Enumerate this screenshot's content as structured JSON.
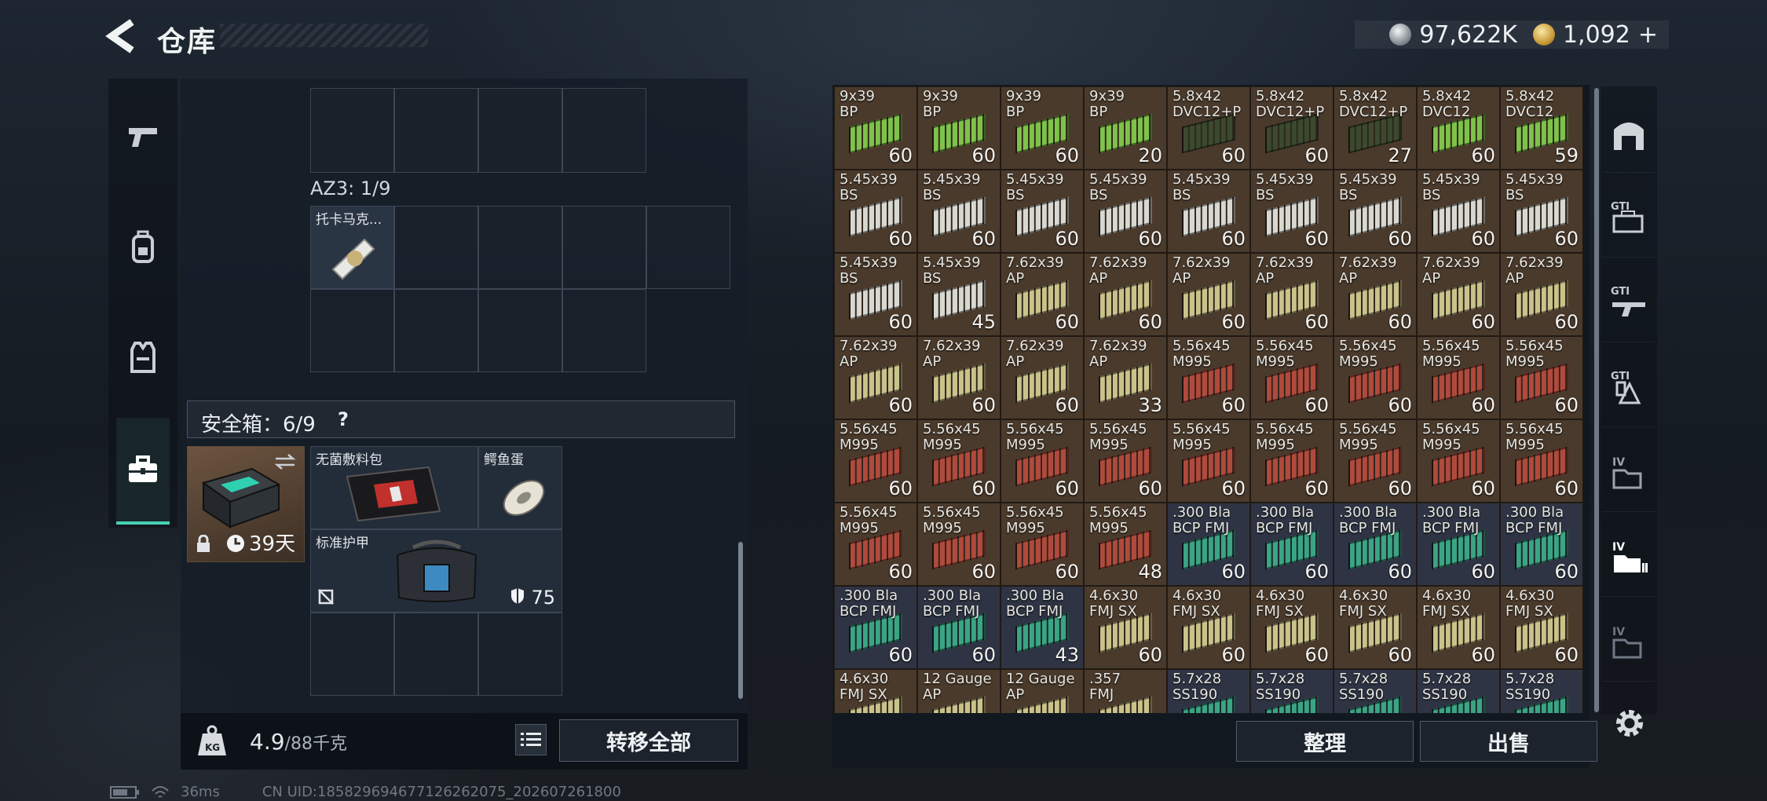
{
  "header": {
    "title": "仓库",
    "back_icon": "chevron-left-icon"
  },
  "currency": {
    "silver": "97,622K",
    "gold": "1,092",
    "plus": "+"
  },
  "left_nav": [
    {
      "icon": "pistol-icon"
    },
    {
      "icon": "backpack-icon"
    },
    {
      "icon": "vest-icon"
    },
    {
      "icon": "briefcase-icon",
      "active": true
    }
  ],
  "container": {
    "az3_label": "AZ3: 1/9",
    "az3_item": "托卡马克...",
    "safe_label": "安全箱：6/9",
    "safe_help": "?",
    "safe_case_days": "39天",
    "items": [
      {
        "name": "无菌敷料包"
      },
      {
        "name": "鳄鱼蛋"
      },
      {
        "name": "标准护甲",
        "durability": "75"
      }
    ]
  },
  "weight": {
    "current": "4.9",
    "max": "/88千克"
  },
  "buttons": {
    "transfer_all": "转移全部",
    "sort": "整理",
    "sell": "出售"
  },
  "stash": [
    {
      "l1": "9x39",
      "l2": "BP",
      "c": "60",
      "k": "g"
    },
    {
      "l1": "9x39",
      "l2": "BP",
      "c": "60",
      "k": "g"
    },
    {
      "l1": "9x39",
      "l2": "BP",
      "c": "60",
      "k": "g"
    },
    {
      "l1": "9x39",
      "l2": "BP",
      "c": "20",
      "k": "g"
    },
    {
      "l1": "5.8x42",
      "l2": "DVC12+P",
      "c": "60",
      "k": "d"
    },
    {
      "l1": "5.8x42",
      "l2": "DVC12+P",
      "c": "60",
      "k": "d"
    },
    {
      "l1": "5.8x42",
      "l2": "DVC12+P",
      "c": "27",
      "k": "d"
    },
    {
      "l1": "5.8x42",
      "l2": "DVC12",
      "c": "60",
      "k": "g"
    },
    {
      "l1": "5.8x42",
      "l2": "DVC12",
      "c": "59",
      "k": "g"
    },
    {
      "l1": "5.45x39",
      "l2": "BS",
      "c": "60",
      "k": "w"
    },
    {
      "l1": "5.45x39",
      "l2": "BS",
      "c": "60",
      "k": "w"
    },
    {
      "l1": "5.45x39",
      "l2": "BS",
      "c": "60",
      "k": "w"
    },
    {
      "l1": "5.45x39",
      "l2": "BS",
      "c": "60",
      "k": "w"
    },
    {
      "l1": "5.45x39",
      "l2": "BS",
      "c": "60",
      "k": "w"
    },
    {
      "l1": "5.45x39",
      "l2": "BS",
      "c": "60",
      "k": "w"
    },
    {
      "l1": "5.45x39",
      "l2": "BS",
      "c": "60",
      "k": "w"
    },
    {
      "l1": "5.45x39",
      "l2": "BS",
      "c": "60",
      "k": "w"
    },
    {
      "l1": "5.45x39",
      "l2": "BS",
      "c": "60",
      "k": "w"
    },
    {
      "l1": "5.45x39",
      "l2": "BS",
      "c": "60",
      "k": "w"
    },
    {
      "l1": "5.45x39",
      "l2": "BS",
      "c": "45",
      "k": "w"
    },
    {
      "l1": "7.62x39",
      "l2": "AP",
      "c": "60",
      "k": "y"
    },
    {
      "l1": "7.62x39",
      "l2": "AP",
      "c": "60",
      "k": "y"
    },
    {
      "l1": "7.62x39",
      "l2": "AP",
      "c": "60",
      "k": "y"
    },
    {
      "l1": "7.62x39",
      "l2": "AP",
      "c": "60",
      "k": "y"
    },
    {
      "l1": "7.62x39",
      "l2": "AP",
      "c": "60",
      "k": "y"
    },
    {
      "l1": "7.62x39",
      "l2": "AP",
      "c": "60",
      "k": "y"
    },
    {
      "l1": "7.62x39",
      "l2": "AP",
      "c": "60",
      "k": "y"
    },
    {
      "l1": "7.62x39",
      "l2": "AP",
      "c": "60",
      "k": "y"
    },
    {
      "l1": "7.62x39",
      "l2": "AP",
      "c": "60",
      "k": "y"
    },
    {
      "l1": "7.62x39",
      "l2": "AP",
      "c": "60",
      "k": "y"
    },
    {
      "l1": "7.62x39",
      "l2": "AP",
      "c": "33",
      "k": "y"
    },
    {
      "l1": "5.56x45",
      "l2": "M995",
      "c": "60",
      "k": "r"
    },
    {
      "l1": "5.56x45",
      "l2": "M995",
      "c": "60",
      "k": "r"
    },
    {
      "l1": "5.56x45",
      "l2": "M995",
      "c": "60",
      "k": "r"
    },
    {
      "l1": "5.56x45",
      "l2": "M995",
      "c": "60",
      "k": "r"
    },
    {
      "l1": "5.56x45",
      "l2": "M995",
      "c": "60",
      "k": "r"
    },
    {
      "l1": "5.56x45",
      "l2": "M995",
      "c": "60",
      "k": "r"
    },
    {
      "l1": "5.56x45",
      "l2": "M995",
      "c": "60",
      "k": "r"
    },
    {
      "l1": "5.56x45",
      "l2": "M995",
      "c": "60",
      "k": "r"
    },
    {
      "l1": "5.56x45",
      "l2": "M995",
      "c": "60",
      "k": "r"
    },
    {
      "l1": "5.56x45",
      "l2": "M995",
      "c": "60",
      "k": "r"
    },
    {
      "l1": "5.56x45",
      "l2": "M995",
      "c": "60",
      "k": "r"
    },
    {
      "l1": "5.56x45",
      "l2": "M995",
      "c": "60",
      "k": "r"
    },
    {
      "l1": "5.56x45",
      "l2": "M995",
      "c": "60",
      "k": "r"
    },
    {
      "l1": "5.56x45",
      "l2": "M995",
      "c": "60",
      "k": "r"
    },
    {
      "l1": "5.56x45",
      "l2": "M995",
      "c": "60",
      "k": "r"
    },
    {
      "l1": "5.56x45",
      "l2": "M995",
      "c": "60",
      "k": "r"
    },
    {
      "l1": "5.56x45",
      "l2": "M995",
      "c": "60",
      "k": "r"
    },
    {
      "l1": "5.56x45",
      "l2": "M995",
      "c": "48",
      "k": "r"
    },
    {
      "l1": ".300 Bla",
      "l2": "BCP FMJ",
      "c": "60",
      "k": "t"
    },
    {
      "l1": ".300 Bla",
      "l2": "BCP FMJ",
      "c": "60",
      "k": "t"
    },
    {
      "l1": ".300 Bla",
      "l2": "BCP FMJ",
      "c": "60",
      "k": "t"
    },
    {
      "l1": ".300 Bla",
      "l2": "BCP FMJ",
      "c": "60",
      "k": "t"
    },
    {
      "l1": ".300 Bla",
      "l2": "BCP FMJ",
      "c": "60",
      "k": "t"
    },
    {
      "l1": ".300 Bla",
      "l2": "BCP FMJ",
      "c": "60",
      "k": "t"
    },
    {
      "l1": ".300 Bla",
      "l2": "BCP FMJ",
      "c": "60",
      "k": "t"
    },
    {
      "l1": ".300 Bla",
      "l2": "BCP FMJ",
      "c": "43",
      "k": "t"
    },
    {
      "l1": "4.6x30",
      "l2": "FMJ SX",
      "c": "60",
      "k": "y"
    },
    {
      "l1": "4.6x30",
      "l2": "FMJ SX",
      "c": "60",
      "k": "y"
    },
    {
      "l1": "4.6x30",
      "l2": "FMJ SX",
      "c": "60",
      "k": "y"
    },
    {
      "l1": "4.6x30",
      "l2": "FMJ SX",
      "c": "60",
      "k": "y"
    },
    {
      "l1": "4.6x30",
      "l2": "FMJ SX",
      "c": "60",
      "k": "y"
    },
    {
      "l1": "4.6x30",
      "l2": "FMJ SX",
      "c": "60",
      "k": "y"
    },
    {
      "l1": "4.6x30",
      "l2": "FMJ SX",
      "c": "",
      "k": "y"
    },
    {
      "l1": "12 Gauge",
      "l2": "AP",
      "c": "",
      "k": "y"
    },
    {
      "l1": "12 Gauge",
      "l2": "AP",
      "c": "",
      "k": "y"
    },
    {
      "l1": ".357",
      "l2": "FMJ",
      "c": "",
      "k": "y"
    },
    {
      "l1": "5.7x28",
      "l2": "SS190",
      "c": "",
      "k": "t"
    },
    {
      "l1": "5.7x28",
      "l2": "SS190",
      "c": "",
      "k": "t"
    },
    {
      "l1": "5.7x28",
      "l2": "SS190",
      "c": "",
      "k": "t"
    },
    {
      "l1": "5.7x28",
      "l2": "SS190",
      "c": "",
      "k": "t"
    },
    {
      "l1": "5.7x28",
      "l2": "SS190",
      "c": "",
      "k": "t"
    }
  ],
  "right_nav": [
    {
      "icon": "armor-icon"
    },
    {
      "icon": "gti-case-icon",
      "label": "GTI"
    },
    {
      "icon": "gti-weapon-icon",
      "label": "GTI"
    },
    {
      "icon": "gti-grenade-icon",
      "label": "GTI"
    },
    {
      "icon": "iv-folder-icon",
      "label": "IV"
    },
    {
      "icon": "iv-folder-icon",
      "label": "IV",
      "active": true
    },
    {
      "icon": "iv-folder-icon",
      "label": "IV"
    }
  ],
  "status": {
    "ping": "36ms",
    "uid": "CN UID:18582969467712626207​5_202607261800"
  },
  "colors": {
    "accent": "#46d1b3",
    "green_box": "#7fc24a",
    "white_box": "#d8d8d2",
    "yellow_box": "#c9c28a",
    "red_box": "#b04a3c",
    "teal_box": "#3aa583"
  }
}
